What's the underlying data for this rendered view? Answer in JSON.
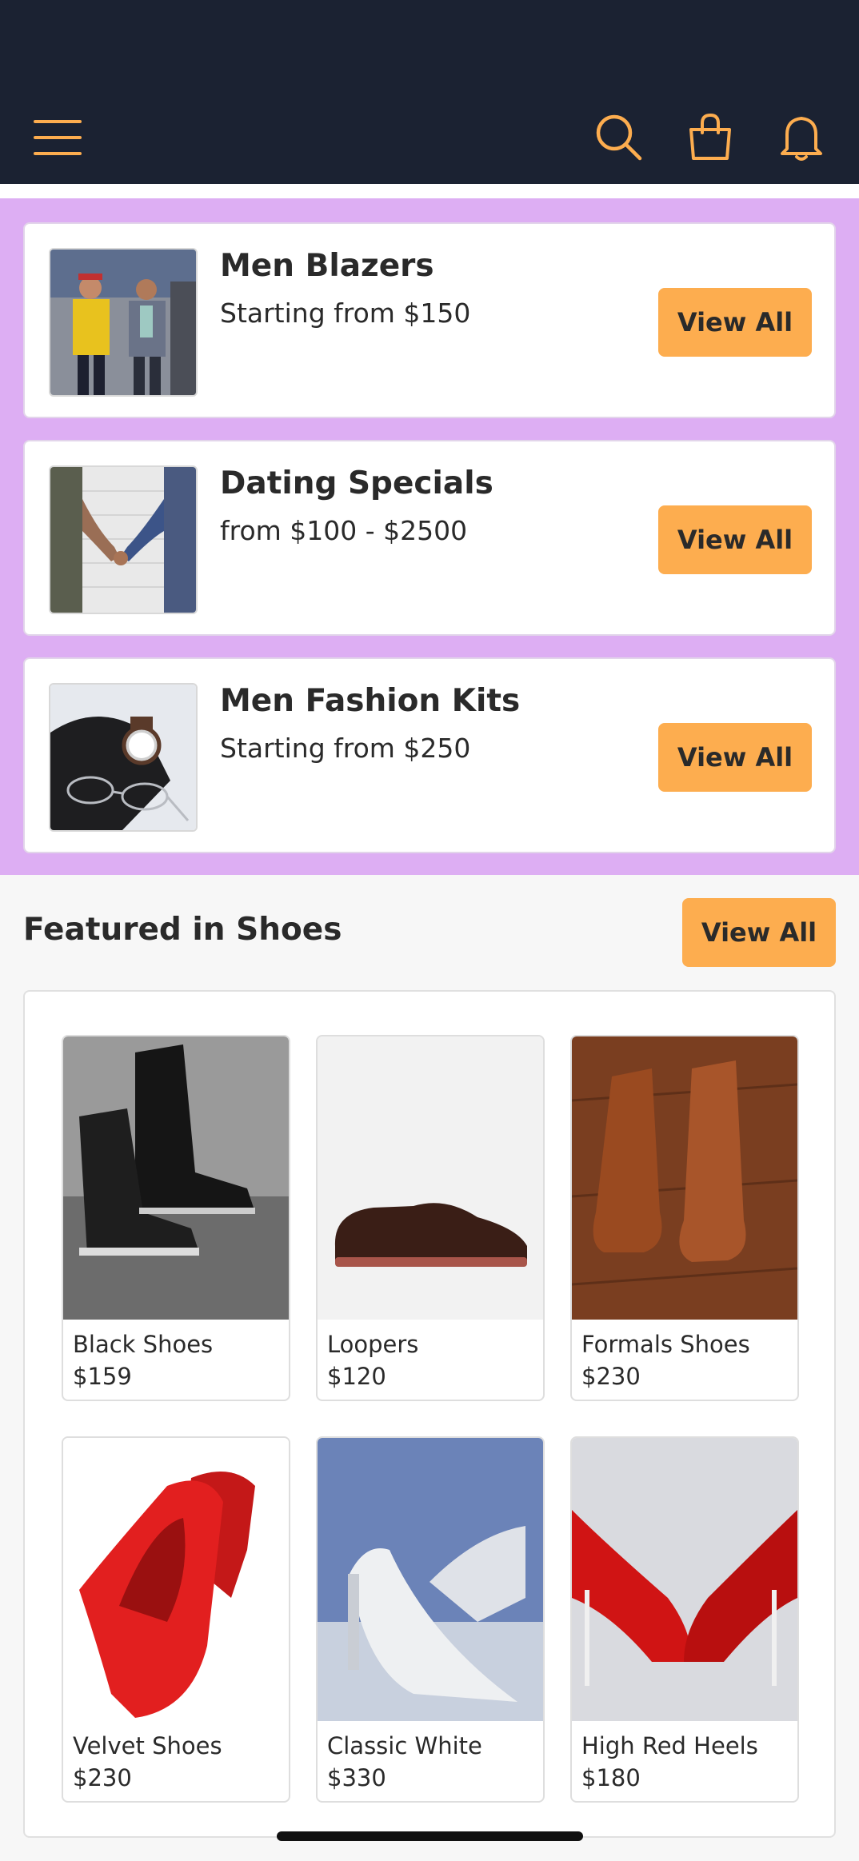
{
  "header": {
    "icons": [
      "menu-icon",
      "search-icon",
      "shopping-bag-icon",
      "notification-bell-icon"
    ],
    "accent_color": "#fdad4f",
    "background_color": "#1b2232"
  },
  "promos": [
    {
      "title": "Men Blazers",
      "subtitle": "Starting from $150",
      "button": "View All"
    },
    {
      "title": "Dating Specials",
      "subtitle": "from $100 - $2500",
      "button": "View All"
    },
    {
      "title": "Men Fashion Kits",
      "subtitle": "Starting from $250",
      "button": "View All"
    }
  ],
  "featured": {
    "title": "Featured in Shoes",
    "button": "View All",
    "products": [
      {
        "name": "Black Shoes",
        "price": "$159"
      },
      {
        "name": "Loopers",
        "price": "$120"
      },
      {
        "name": "Formals Shoes",
        "price": "$230"
      },
      {
        "name": "Velvet Shoes",
        "price": "$230"
      },
      {
        "name": "Classic White",
        "price": "$330"
      },
      {
        "name": "High Red Heels",
        "price": "$180"
      }
    ]
  },
  "colors": {
    "promo_background": "#ddaef3",
    "button": "#fdad4f"
  }
}
